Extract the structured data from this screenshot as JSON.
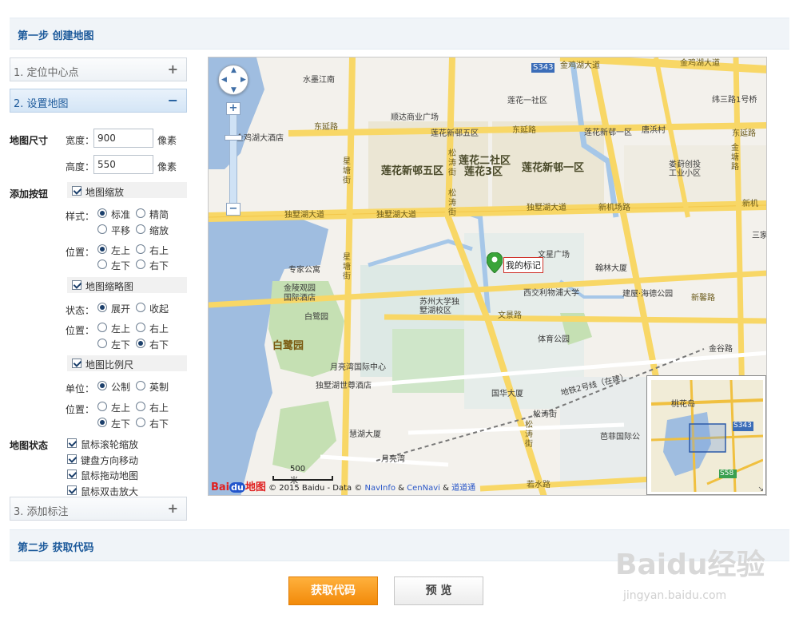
{
  "step1": {
    "title": "第一步 创建地图"
  },
  "step2": {
    "title": "第二步 获取代码"
  },
  "panels": [
    {
      "label": "1. 定位中心点",
      "sign": "+"
    },
    {
      "label": "2. 设置地图",
      "sign": "−"
    },
    {
      "label": "3. 添加标注",
      "sign": "+"
    }
  ],
  "map_size": {
    "label": "地图尺寸",
    "width_label": "宽度：",
    "width_value": "900",
    "height_label": "高度：",
    "height_value": "550",
    "unit": "像素"
  },
  "add_buttons": {
    "label": "添加按钮",
    "zoom": {
      "label": "地图缩放",
      "style_label": "样式：",
      "styles": [
        "标准",
        "精简",
        "平移",
        "缩放"
      ],
      "pos_label": "位置：",
      "positions": [
        "左上",
        "右上",
        "左下",
        "右下"
      ]
    },
    "overview": {
      "label": "地图缩略图",
      "state_label": "状态：",
      "states": [
        "展开",
        "收起"
      ],
      "pos_label": "位置：",
      "positions": [
        "左上",
        "右上",
        "左下",
        "右下"
      ]
    },
    "scale": {
      "label": "地图比例尺",
      "unit_label": "单位：",
      "units": [
        "公制",
        "英制"
      ],
      "pos_label": "位置：",
      "positions": [
        "左上",
        "右上",
        "左下",
        "右下"
      ]
    }
  },
  "map_state": {
    "label": "地图状态",
    "options": [
      "鼠标滚轮缩放",
      "键盘方向移动",
      "鼠标拖动地图",
      "鼠标双击放大"
    ]
  },
  "map": {
    "marker_label": "我的标记",
    "scale_label": "500 米",
    "copyright_prefix": "© 2015 Baidu - Data ©",
    "copyright_src1": "NavInfo",
    "copyright_amp": "&",
    "copyright_src2": "CenNavi",
    "copyright_amp2": "&",
    "copyright_src3": "道道通",
    "logo_text": "Bai",
    "logo_du": "du",
    "logo_suffix": "地图",
    "labels": {
      "jinji_dadao": "金鸡湖大道",
      "jinji_dadao2": "金鸡湖大道",
      "shuimo": "水墨江南",
      "shundasi": "顺达商业广场",
      "lianhua1": "莲花一社区",
      "weisan": "纬三路1号桥",
      "dongyan": "东延路",
      "dongyan2": "东延路",
      "dongyan3": "东延路",
      "lianhua_xin5": "莲花新邨五区",
      "lianhua_xin1": "莲花新邨一区",
      "tangbin": "唐浜村",
      "jinji_hotel": "金鸡湖大酒店",
      "liuhua5": "莲花新邨五区",
      "liuhua23": "莲花二社区",
      "liuhua3": "莲花3区",
      "liuhua1big": "莲花新邨一区",
      "weichuang": "娄葑创投",
      "gongye": "工业小区",
      "xingtang": "星塘街",
      "xingtang2": "星塘街",
      "songtao": "松涛街",
      "songtao2": "松涛街",
      "songtao3": "松涛街",
      "dushu": "独墅湖大道",
      "dushu2": "独墅湖大道",
      "dushu3": "独墅湖大道",
      "xinjichang": "新机场路",
      "xinji": "新机",
      "s343": "S343",
      "s343b": "S343",
      "s58": "S58",
      "jinting": "金塘路",
      "sansan": "三家",
      "zhuanjia": "专家公寓",
      "jinling": "金陵观园",
      "guoji": "国际酒店",
      "bailuyuan": "白鹭园",
      "bailuyuan_big": "白鹭园",
      "suda": "苏州大学独",
      "suda2": "墅湖校区",
      "wenjing": "文景路",
      "xinhu": "新馨路",
      "xijiao": "西交利物浦大学",
      "jianwu": "建屋·海德公园",
      "hanlin": "翰林大厦",
      "tiyu": "体育公园",
      "jingu": "金谷路",
      "yueliangwan": "月亮湾国际中心",
      "shizun": "独墅湖世尊酒店",
      "guohua": "国华大厦",
      "ditie": "地铁2号线（在建）",
      "songtao_st": "松涛街",
      "bafeng": "芭菲国际公",
      "huihu": "慧湖大厦",
      "yueliangwan2": "月亮湾",
      "ruoshui": "若水路",
      "ov_taohua": "桃花岛",
      "ov_s343": "S343",
      "ov_s58": "S58",
      "xingguang": "文星广场",
      "xiang": "巷"
    }
  },
  "buttons": {
    "get_code": "获取代码",
    "preview": "预 览"
  },
  "watermark": {
    "text": "Baidu经验",
    "url": "jingyan.baidu.com"
  }
}
